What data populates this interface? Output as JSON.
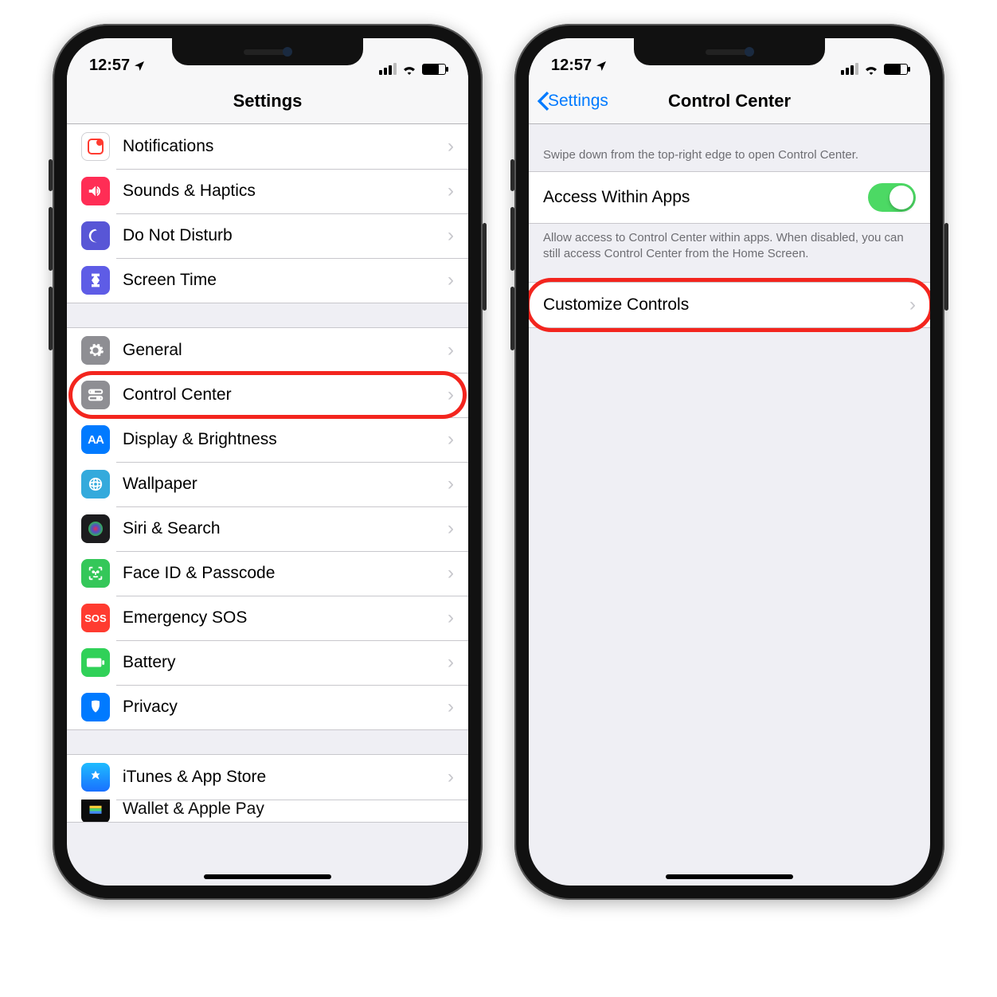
{
  "status": {
    "time": "12:57",
    "location_arrow": "➤"
  },
  "left_phone": {
    "title": "Settings",
    "group1": [
      {
        "label": "Notifications"
      },
      {
        "label": "Sounds & Haptics"
      },
      {
        "label": "Do Not Disturb"
      },
      {
        "label": "Screen Time"
      }
    ],
    "group2": [
      {
        "label": "General"
      },
      {
        "label": "Control Center"
      },
      {
        "label": "Display & Brightness"
      },
      {
        "label": "Wallpaper"
      },
      {
        "label": "Siri & Search"
      },
      {
        "label": "Face ID & Passcode"
      },
      {
        "label": "Emergency SOS"
      },
      {
        "label": "Battery"
      },
      {
        "label": "Privacy"
      }
    ],
    "group3": [
      {
        "label": "iTunes & App Store"
      },
      {
        "label": "Wallet & Apple Pay"
      }
    ]
  },
  "right_phone": {
    "back_label": "Settings",
    "title": "Control Center",
    "header_text": "Swipe down from the top-right edge to open Control Center.",
    "access_label": "Access Within Apps",
    "access_footer": "Allow access to Control Center within apps. When disabled, you can still access Control Center from the Home Screen.",
    "customize_label": "Customize Controls"
  }
}
